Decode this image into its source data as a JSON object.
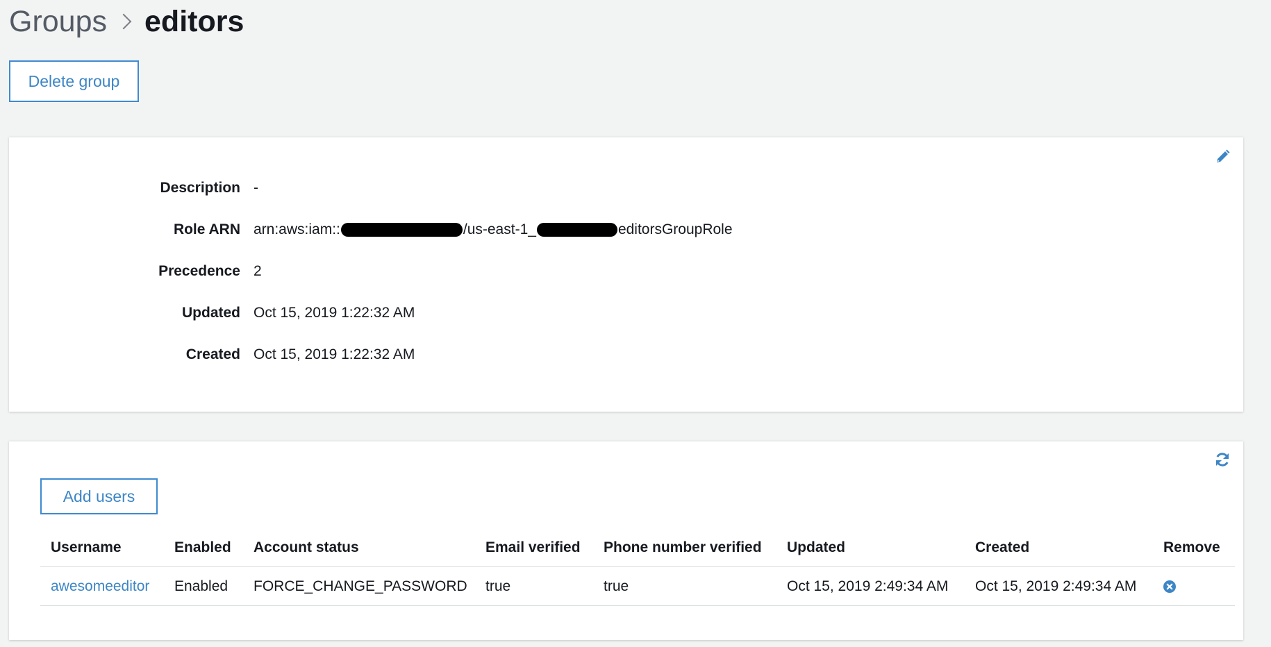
{
  "breadcrumb": {
    "parent": "Groups",
    "current": "editors"
  },
  "actions": {
    "delete_group": "Delete group",
    "add_users": "Add users"
  },
  "details": {
    "description": {
      "label": "Description",
      "value": "-"
    },
    "role_arn": {
      "label": "Role ARN",
      "prefix": "arn:aws:iam::",
      "middle": "/us-east-1_",
      "suffix": "editorsGroupRole"
    },
    "precedence": {
      "label": "Precedence",
      "value": "2"
    },
    "updated": {
      "label": "Updated",
      "value": "Oct 15, 2019 1:22:32 AM"
    },
    "created": {
      "label": "Created",
      "value": "Oct 15, 2019 1:22:32 AM"
    }
  },
  "users_table": {
    "columns": {
      "username": "Username",
      "enabled": "Enabled",
      "account_status": "Account status",
      "email_verified": "Email verified",
      "phone_verified": "Phone number verified",
      "updated": "Updated",
      "created": "Created",
      "remove": "Remove"
    },
    "rows": [
      {
        "username": "awesomeeditor",
        "enabled": "Enabled",
        "account_status": "FORCE_CHANGE_PASSWORD",
        "email_verified": "true",
        "phone_verified": "true",
        "updated": "Oct 15, 2019 2:49:34 AM",
        "created": "Oct 15, 2019 2:49:34 AM"
      }
    ]
  },
  "icons": {
    "edit": "pencil-icon",
    "refresh": "refresh-icon",
    "remove": "remove-circle-icon",
    "separator": "chevron-right-icon"
  },
  "colors": {
    "accent": "#3d86c6",
    "background": "#f2f3f3",
    "card": "#ffffff",
    "text": "#16191f"
  }
}
